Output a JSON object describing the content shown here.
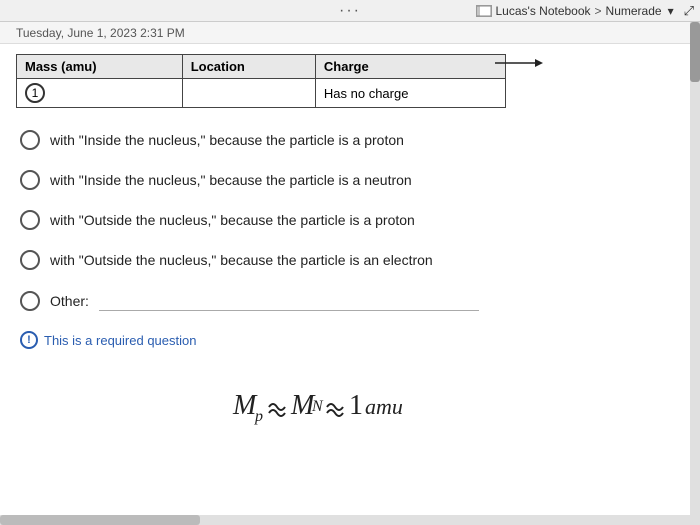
{
  "topbar": {
    "dots": "···",
    "notebook_label": "Lucas's Notebook",
    "breadcrumb_separator": ">",
    "platform": "Numerade",
    "dropdown_icon": "▾",
    "expand_icon": "⤢"
  },
  "prev_content": {
    "text": "Tuesday, June 1, 2023   2:31 PM"
  },
  "table": {
    "headers": [
      "Mass (amu)",
      "Location",
      "Charge"
    ],
    "row": {
      "mass": "1",
      "location": "",
      "charge": "Has no charge"
    }
  },
  "options": [
    {
      "id": "opt1",
      "label": "with \"Inside the nucleus,\" because the particle is a proton"
    },
    {
      "id": "opt2",
      "label": "with \"Inside the nucleus,\" because the particle is a neutron"
    },
    {
      "id": "opt3",
      "label": "with \"Outside the nucleus,\" because the particle is a proton"
    },
    {
      "id": "opt4",
      "label": "with \"Outside the nucleus,\" because the particle is an electron"
    }
  ],
  "other_label": "Other:",
  "other_placeholder": "",
  "required_icon": "!",
  "required_text": "This is a required question",
  "math_display": "Mₚ ≈ M_N ≈ 1amu"
}
